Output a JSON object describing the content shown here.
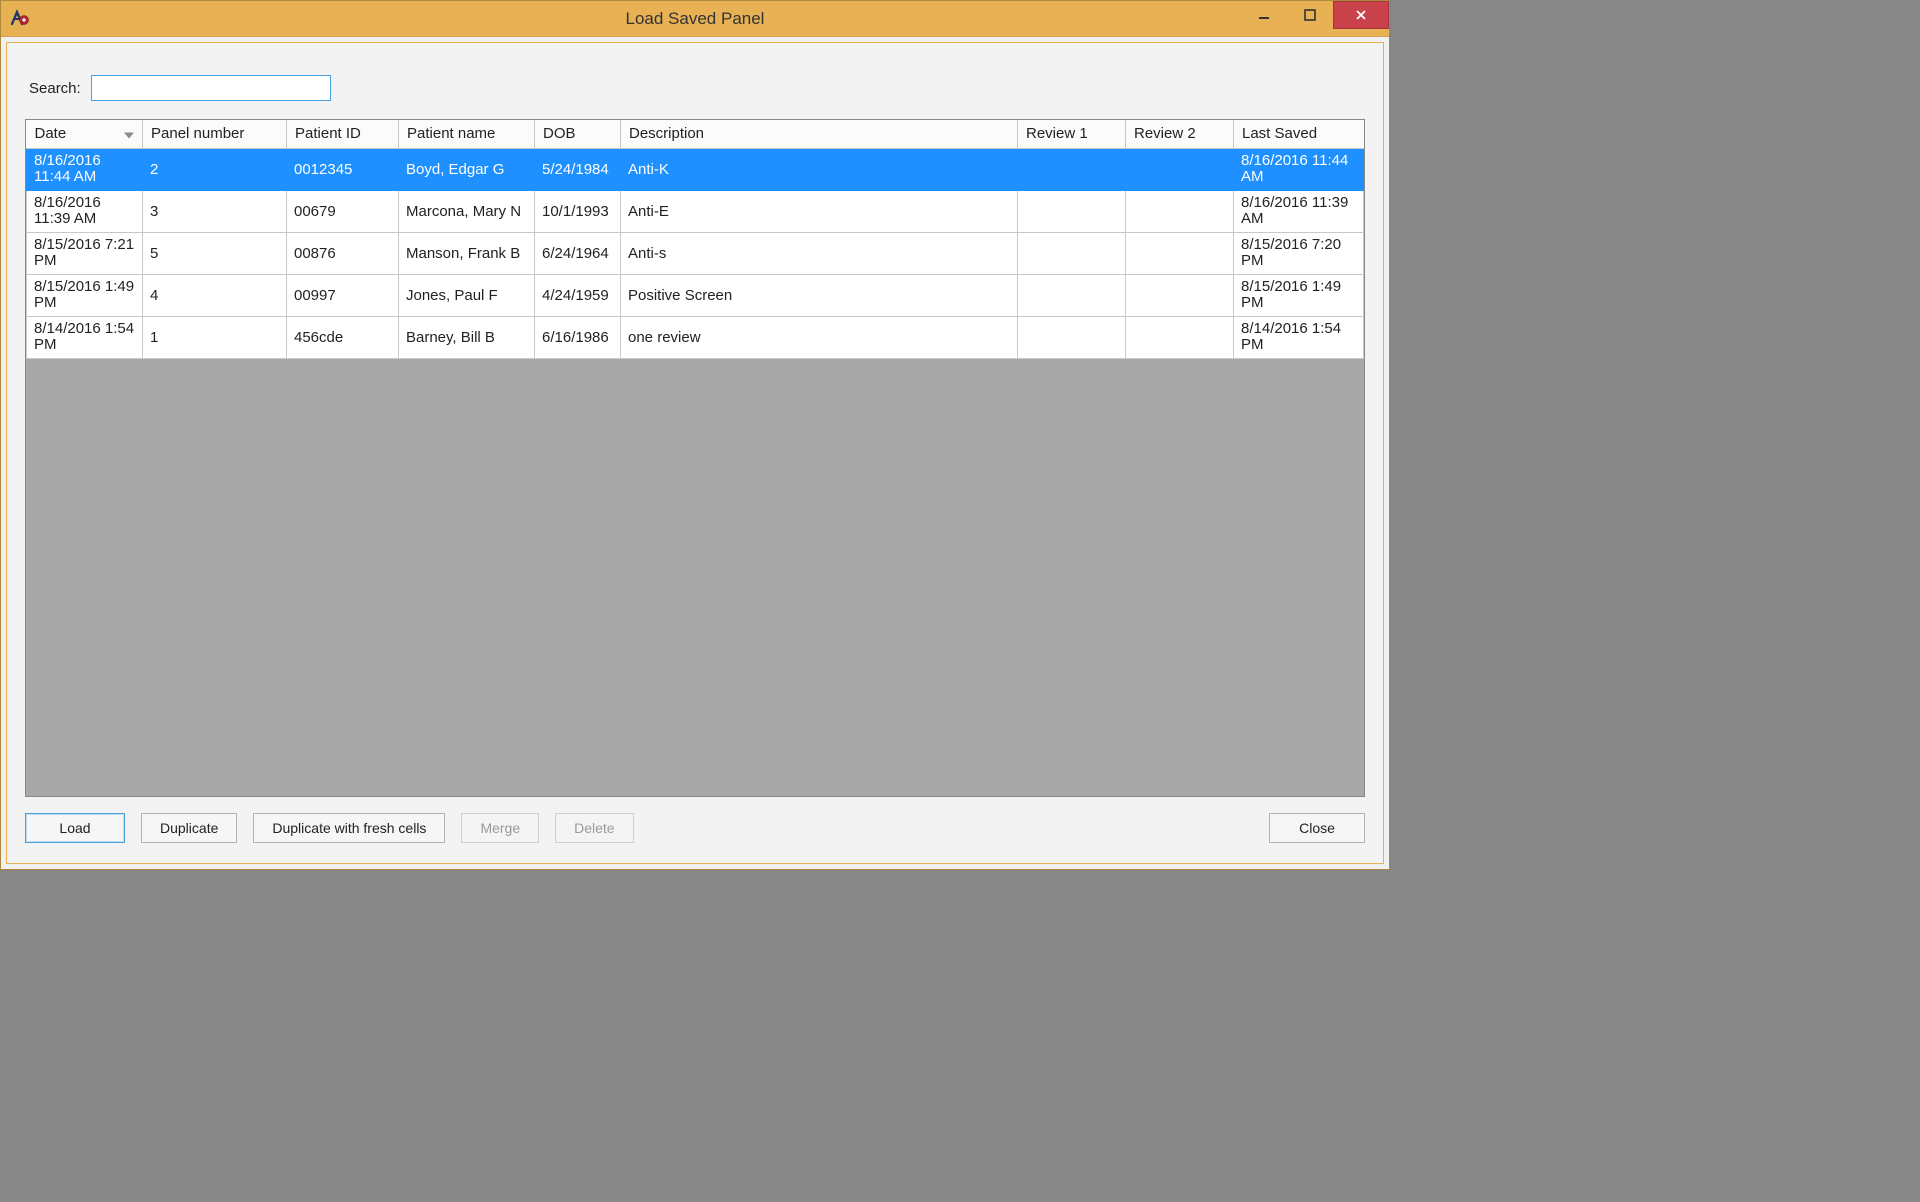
{
  "window": {
    "title": "Load Saved Panel"
  },
  "search": {
    "label": "Search:",
    "value": ""
  },
  "columns": {
    "date": "Date",
    "panel_number": "Panel number",
    "patient_id": "Patient ID",
    "patient_name": "Patient name",
    "dob": "DOB",
    "description": "Description",
    "review1": "Review 1",
    "review2": "Review 2",
    "last_saved": "Last Saved"
  },
  "rows": [
    {
      "date": "8/16/2016 11:44 AM",
      "panel_number": "2",
      "patient_id": "0012345",
      "patient_name": "Boyd, Edgar G",
      "dob": "5/24/1984",
      "description": "Anti-K",
      "review1": "",
      "review2": "",
      "last_saved": "8/16/2016 11:44 AM",
      "selected": true
    },
    {
      "date": "8/16/2016 11:39 AM",
      "panel_number": "3",
      "patient_id": "00679",
      "patient_name": "Marcona, Mary N",
      "dob": "10/1/1993",
      "description": "Anti-E",
      "review1": "",
      "review2": "",
      "last_saved": "8/16/2016 11:39 AM"
    },
    {
      "date": "8/15/2016 7:21 PM",
      "panel_number": "5",
      "patient_id": "00876",
      "patient_name": "Manson, Frank B",
      "dob": "6/24/1964",
      "description": "Anti-s",
      "review1": "",
      "review2": "",
      "last_saved": "8/15/2016 7:20 PM"
    },
    {
      "date": "8/15/2016 1:49 PM",
      "panel_number": "4",
      "patient_id": "00997",
      "patient_name": "Jones, Paul F",
      "dob": "4/24/1959",
      "description": "Positive Screen",
      "review1": "",
      "review2": "",
      "last_saved": "8/15/2016 1:49 PM"
    },
    {
      "date": "8/14/2016 1:54 PM",
      "panel_number": "1",
      "patient_id": "456cde",
      "patient_name": "Barney, Bill B",
      "dob": "6/16/1986",
      "description": "one review",
      "review1": "",
      "review2": "",
      "last_saved": "8/14/2016 1:54 PM"
    }
  ],
  "buttons": {
    "load": "Load",
    "duplicate": "Duplicate",
    "duplicate_fresh": "Duplicate with fresh cells",
    "merge": "Merge",
    "delete": "Delete",
    "close": "Close"
  }
}
